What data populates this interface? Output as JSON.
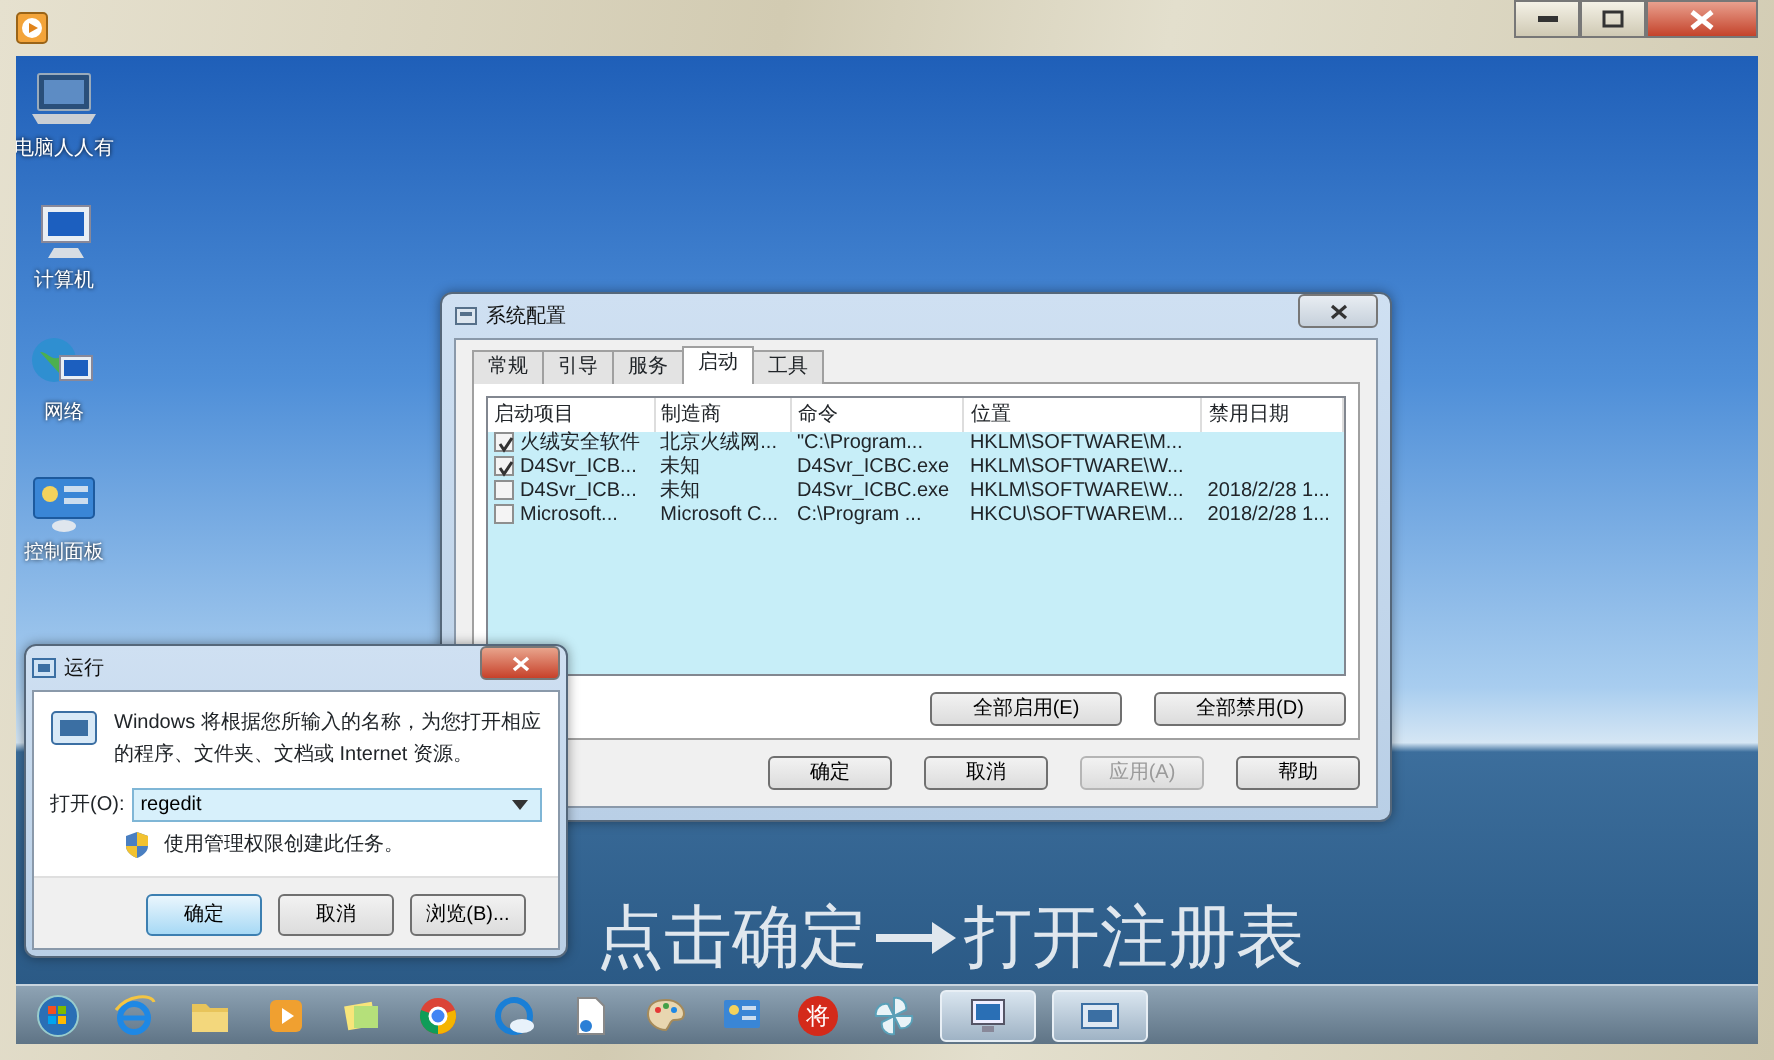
{
  "desktop": {
    "icons": [
      {
        "kind": "laptop",
        "label": "电脑人人有"
      },
      {
        "kind": "computer",
        "label": "计算机"
      },
      {
        "kind": "network",
        "label": "网络"
      },
      {
        "kind": "panel",
        "label": "控制面板"
      }
    ]
  },
  "msconfig": {
    "title": "系统配置",
    "tabs": [
      {
        "label": "常规",
        "selected": false
      },
      {
        "label": "引导",
        "selected": false
      },
      {
        "label": "服务",
        "selected": false
      },
      {
        "label": "启动",
        "selected": true
      },
      {
        "label": "工具",
        "selected": false
      }
    ],
    "columns": [
      "启动项目",
      "制造商",
      "命令",
      "位置",
      "禁用日期"
    ],
    "rows": [
      {
        "checked": true,
        "cells": [
          "火绒安全软件",
          "北京火绒网...",
          "\"C:\\Program...",
          "HKLM\\SOFTWARE\\M...",
          ""
        ]
      },
      {
        "checked": true,
        "cells": [
          "D4Svr_ICB...",
          "未知",
          "D4Svr_ICBC.exe",
          "HKLM\\SOFTWARE\\W...",
          ""
        ]
      },
      {
        "checked": false,
        "cells": [
          "D4Svr_ICB...",
          "未知",
          "D4Svr_ICBC.exe",
          "HKLM\\SOFTWARE\\W...",
          "2018/2/28 1..."
        ]
      },
      {
        "checked": false,
        "cells": [
          "Microsoft...",
          "Microsoft C...",
          "C:\\Program ...",
          "HKCU\\SOFTWARE\\M...",
          "2018/2/28 1..."
        ]
      }
    ],
    "list_buttons": [
      "全部启用(E)",
      "全部禁用(D)"
    ],
    "buttons": [
      {
        "label": "确定",
        "disabled": false
      },
      {
        "label": "取消",
        "disabled": false
      },
      {
        "label": "应用(A)",
        "disabled": true
      },
      {
        "label": "帮助",
        "disabled": false
      }
    ]
  },
  "run": {
    "title": "运行",
    "description": "Windows 将根据您所输入的名称，为您打开相应的程序、文件夹、文档或 Internet 资源。",
    "open_label": "打开(O):",
    "value": "regedit",
    "admin_note": "使用管理权限创建此任务。",
    "buttons": [
      {
        "label": "确定",
        "focused": true
      },
      {
        "label": "取消",
        "focused": false
      },
      {
        "label": "浏览(B)...",
        "focused": false
      }
    ]
  },
  "caption": {
    "before": "点击确定",
    "after": "打开注册表"
  },
  "taskbar": {
    "items": [
      {
        "kind": "start",
        "active": false
      },
      {
        "kind": "browser",
        "active": false
      },
      {
        "kind": "folder",
        "active": false
      },
      {
        "kind": "media",
        "active": false
      },
      {
        "kind": "notes",
        "active": false
      },
      {
        "kind": "chrome",
        "active": false
      },
      {
        "kind": "cloud",
        "active": false
      },
      {
        "kind": "document",
        "active": false
      },
      {
        "kind": "paint",
        "active": false
      },
      {
        "kind": "panel",
        "active": false
      },
      {
        "kind": "badge",
        "text": "将",
        "active": false
      },
      {
        "kind": "pinwheel",
        "active": false
      },
      {
        "kind": "monitor",
        "active": true
      },
      {
        "kind": "window",
        "active": true
      }
    ]
  }
}
